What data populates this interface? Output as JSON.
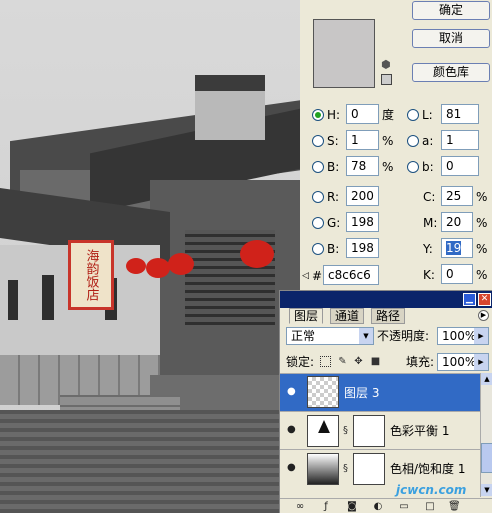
{
  "picker": {
    "ok_label": "确定",
    "cancel_label": "取消",
    "color_library_label": "颜色库",
    "swatch_color": "#c8c6c6",
    "hsb": [
      {
        "label": "H:",
        "value": "0",
        "unit": "度",
        "selected": true
      },
      {
        "label": "S:",
        "value": "1",
        "unit": "%",
        "selected": false
      },
      {
        "label": "B:",
        "value": "78",
        "unit": "%",
        "selected": false
      }
    ],
    "rgb": [
      {
        "label": "R:",
        "value": "200"
      },
      {
        "label": "G:",
        "value": "198"
      },
      {
        "label": "B:",
        "value": "198"
      }
    ],
    "lab": [
      {
        "label": "L:",
        "value": "81"
      },
      {
        "label": "a:",
        "value": "1"
      },
      {
        "label": "b:",
        "value": "0"
      }
    ],
    "cmyk": [
      {
        "label": "C:",
        "value": "25",
        "unit": "%"
      },
      {
        "label": "M:",
        "value": "20",
        "unit": "%"
      },
      {
        "label": "Y:",
        "value": "19",
        "unit": "%"
      },
      {
        "label": "K:",
        "value": "0",
        "unit": "%"
      }
    ],
    "hex_label": "#",
    "hex_value": "c8c6c6"
  },
  "layers": {
    "tabs": [
      "图层",
      "通道",
      "路径"
    ],
    "blend_mode": "正常",
    "opacity_label": "不透明度:",
    "opacity_value": "100%",
    "lock_label": "锁定:",
    "fill_label": "填充:",
    "fill_value": "100%",
    "items": [
      {
        "name": "图层 3",
        "type": "pixel",
        "selected": true
      },
      {
        "name": "色彩平衡 1",
        "type": "adjustment",
        "selected": false
      },
      {
        "name": "色相/饱和度 1",
        "type": "adjustment",
        "selected": false
      }
    ]
  },
  "photo": {
    "banner_text": "海韵饭店"
  },
  "watermark": "jcwcn.com"
}
